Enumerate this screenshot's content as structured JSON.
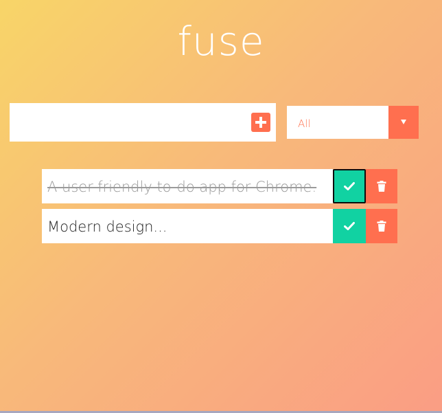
{
  "app": {
    "title": "fuse"
  },
  "add_bar": {
    "input_value": "",
    "add_icon": "plus-square-icon"
  },
  "filter": {
    "selected": "All",
    "arrow_icon": "caret-down-icon"
  },
  "todos": [
    {
      "text": "A user-friendly to-do app for Chrome.",
      "completed": true,
      "complete_icon": "check-icon",
      "delete_icon": "trash-icon"
    },
    {
      "text": "Modern design...",
      "completed": false,
      "complete_icon": "check-icon",
      "delete_icon": "trash-icon"
    }
  ],
  "colors": {
    "accent": "#ff6f4f",
    "success": "#11d2a2",
    "background_start": "#f8d568",
    "background_end": "#fa9d84"
  }
}
